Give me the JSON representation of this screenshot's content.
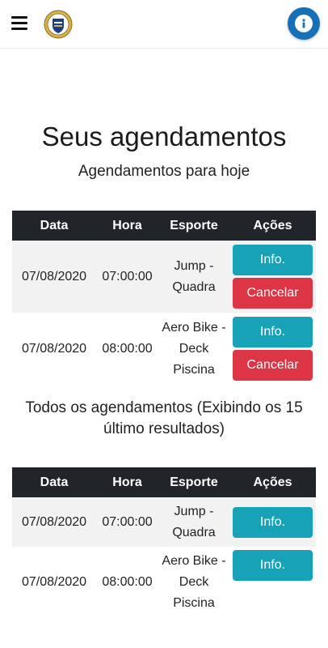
{
  "header": {
    "menu_icon": "hamburger-menu-icon",
    "logo_icon": "institution-crest-icon",
    "info_icon": "info-circle-icon",
    "info_color": "#1670b8"
  },
  "page": {
    "title": "Seus agendamentos",
    "subtitle": "Agendamentos para hoje",
    "all_title": "Todos os agendamentos (Exibindo os 15 último resultados)"
  },
  "columns": [
    "Data",
    "Hora",
    "Esporte",
    "Ações"
  ],
  "today": [
    {
      "date": "07/08/2020",
      "time": "07:00:00",
      "sport": "Jump - Quadra",
      "info": "Info.",
      "cancel": "Cancelar"
    },
    {
      "date": "07/08/2020",
      "time": "08:00:00",
      "sport": "Aero Bike - Deck Piscina",
      "info": "Info.",
      "cancel": "Cancelar"
    }
  ],
  "all": [
    {
      "date": "07/08/2020",
      "time": "07:00:00",
      "sport": "Jump - Quadra",
      "info": "Info."
    },
    {
      "date": "07/08/2020",
      "time": "08:00:00",
      "sport": "Aero Bike - Deck Piscina",
      "info": "Info."
    }
  ],
  "colors": {
    "info_button": "#17a2b8",
    "cancel_button": "#dc3545",
    "table_header": "#212529"
  }
}
